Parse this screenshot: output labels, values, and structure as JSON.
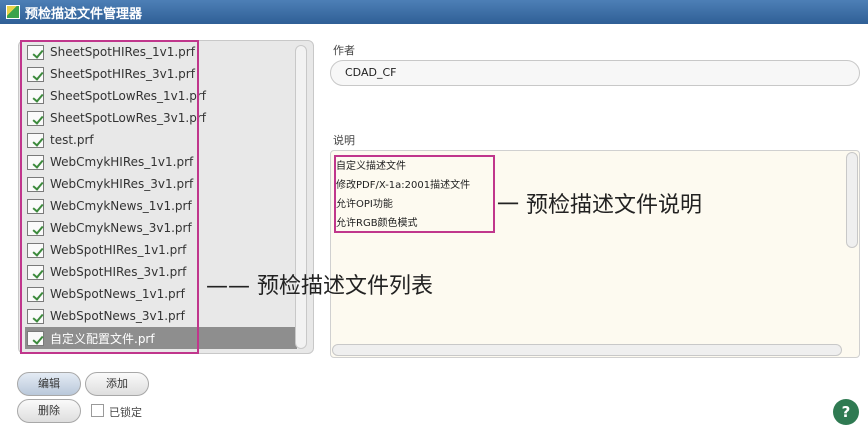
{
  "window": {
    "title": "预检描述文件管理器"
  },
  "profiles": [
    {
      "name": "SheetSpotHIRes_1v1.prf",
      "selected": false
    },
    {
      "name": "SheetSpotHIRes_3v1.prf",
      "selected": false
    },
    {
      "name": "SheetSpotLowRes_1v1.prf",
      "selected": false
    },
    {
      "name": "SheetSpotLowRes_3v1.prf",
      "selected": false
    },
    {
      "name": "test.prf",
      "selected": false
    },
    {
      "name": "WebCmykHIRes_1v1.prf",
      "selected": false
    },
    {
      "name": "WebCmykHIRes_3v1.prf",
      "selected": false
    },
    {
      "name": "WebCmykNews_1v1.prf",
      "selected": false
    },
    {
      "name": "WebCmykNews_3v1.prf",
      "selected": false
    },
    {
      "name": "WebSpotHIRes_1v1.prf",
      "selected": false
    },
    {
      "name": "WebSpotHIRes_3v1.prf",
      "selected": false
    },
    {
      "name": "WebSpotNews_1v1.prf",
      "selected": false
    },
    {
      "name": "WebSpotNews_3v1.prf",
      "selected": false
    },
    {
      "name": "自定义配置文件.prf",
      "selected": true
    }
  ],
  "author": {
    "label": "作者",
    "value": "CDAD_CF"
  },
  "description": {
    "label": "说明",
    "lines": [
      "自定义描述文件",
      "修改PDF/X-1a:2001描述文件",
      "允许OPI功能",
      "允许RGB颜色模式"
    ]
  },
  "annotations": {
    "description": "一 预检描述文件说明",
    "list": "—— 预检描述文件列表"
  },
  "buttons": {
    "edit": "编辑",
    "add": "添加",
    "delete": "删除",
    "locked_label": "已锁定",
    "help": "?"
  },
  "colors": {
    "highlight": "#c0368c",
    "title_bar": "#3a6aa3",
    "selected_row": "#8e8e8e",
    "help_button": "#2f7a52"
  }
}
